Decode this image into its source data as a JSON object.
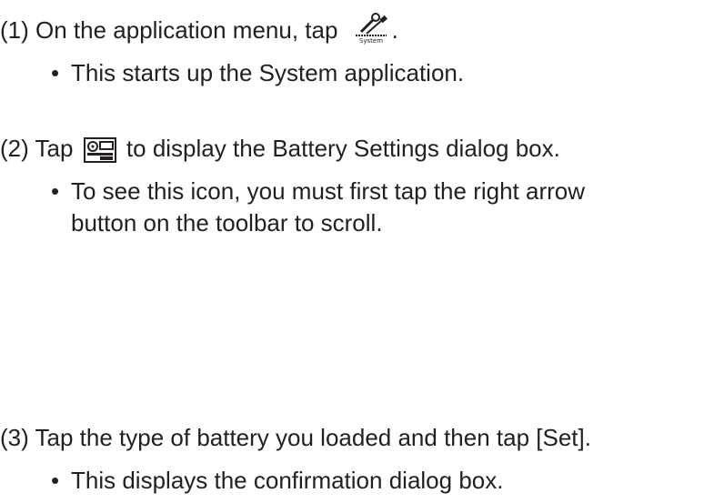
{
  "steps": [
    {
      "prefix": "(1) On the application menu, tap ",
      "icon": "system-app-icon",
      "suffix": ".",
      "bullets": [
        [
          "This starts up the System application."
        ]
      ]
    },
    {
      "prefix": "(2) Tap ",
      "icon": "battery-settings-icon",
      "suffix": " to display the Battery Settings dialog box.",
      "bullets": [
        [
          "To see this icon, you must first tap the right arrow",
          "button on the toolbar to scroll."
        ]
      ]
    },
    {
      "text": "(3) Tap the type of battery you loaded and then tap [Set].",
      "bullets": [
        [
          "This displays the confirmation dialog box."
        ]
      ]
    }
  ],
  "icons": {
    "system_label": "System"
  },
  "bullet_glyph": "•"
}
